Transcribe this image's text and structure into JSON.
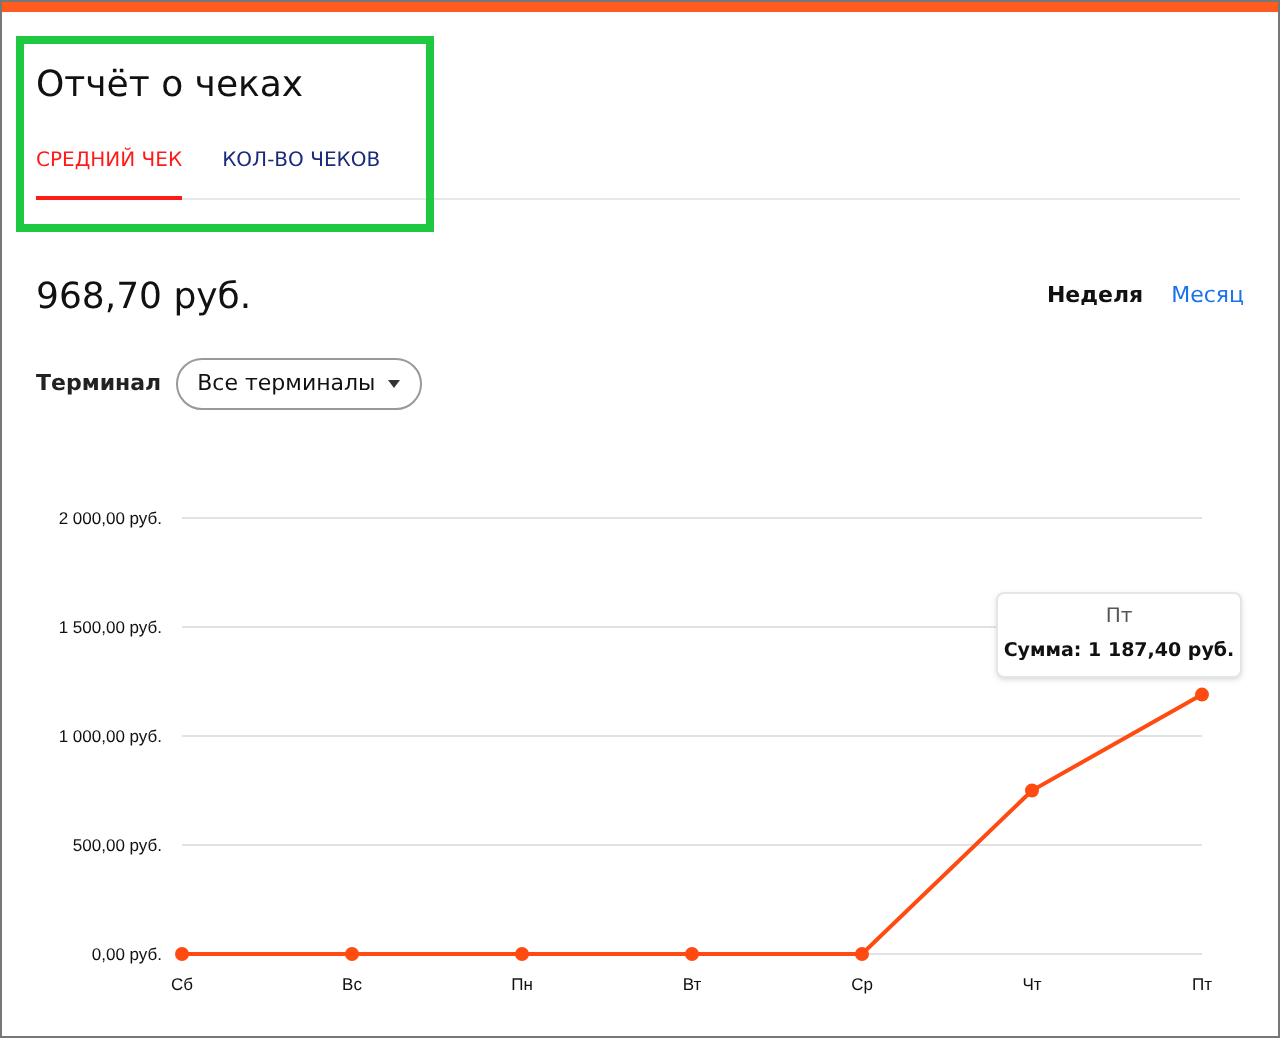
{
  "highlight_frame": true,
  "title": "Отчёт о чеках",
  "tabs": [
    {
      "label": "СРЕДНИЙ ЧЕК",
      "selected": true
    },
    {
      "label": "КОЛ-ВО ЧЕКОВ",
      "selected": false
    }
  ],
  "amount": "968,70 руб.",
  "periods": [
    {
      "label": "Неделя",
      "selected": true
    },
    {
      "label": "Месяц",
      "selected": false
    }
  ],
  "filter": {
    "label": "Терминал",
    "value": "Все терминалы"
  },
  "chart": {
    "chart_data": {
      "type": "line",
      "categories": [
        "Сб",
        "Вс",
        "Пн",
        "Вт",
        "Ср",
        "Чт",
        "Пт"
      ],
      "series": [
        {
          "color": "#ff4b12",
          "marker": "circle",
          "values": [
            0,
            0,
            0,
            0,
            0,
            750,
            1190
          ]
        }
      ],
      "grid": true,
      "ylim": [
        0,
        2000
      ],
      "yticks": [
        {
          "value": 0,
          "label": "0,00 руб."
        },
        {
          "value": 500,
          "label": "500,00 руб."
        },
        {
          "value": 1000,
          "label": "1 000,00 руб."
        },
        {
          "value": 1500,
          "label": "1 500,00 руб."
        },
        {
          "value": 2000,
          "label": "2 000,00 руб."
        }
      ]
    },
    "tooltip": {
      "title": "Пт",
      "label": "Сумма:",
      "value": "1 187,40 руб."
    }
  }
}
